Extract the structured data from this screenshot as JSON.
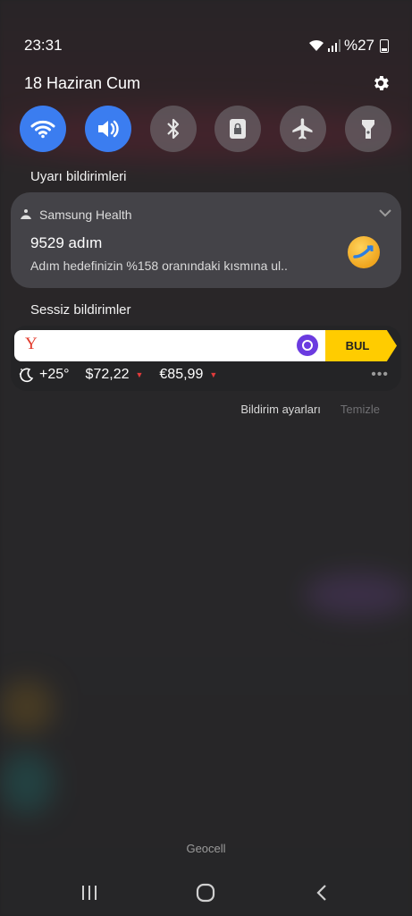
{
  "status_bar": {
    "time": "23:31",
    "battery_text": "%27"
  },
  "header": {
    "date": "18 Haziran Cum",
    "settings_icon": "gear-icon"
  },
  "quick_toggles": [
    {
      "name": "wifi",
      "icon": "wifi-icon",
      "active": true
    },
    {
      "name": "sound",
      "icon": "speaker-icon",
      "active": true
    },
    {
      "name": "bluetooth",
      "icon": "bluetooth-icon",
      "active": false
    },
    {
      "name": "rotation-lock",
      "icon": "lock-icon",
      "active": false
    },
    {
      "name": "airplane",
      "icon": "airplane-icon",
      "active": false
    },
    {
      "name": "flashlight",
      "icon": "flashlight-icon",
      "active": false
    }
  ],
  "sections": {
    "alerts_label": "Uyarı bildirimleri",
    "silent_label": "Sessiz bildirimler"
  },
  "health_notification": {
    "app_name": "Samsung Health",
    "title": "9529 adım",
    "text": "Adım hedefinizin %158 oranındaki kısmına ul.."
  },
  "yandex_widget": {
    "logo_letter": "Y",
    "search_button": "BUL",
    "weather": "+25°",
    "usd": "$72,22",
    "eur": "€85,99",
    "more": "•••"
  },
  "actions": {
    "settings": "Bildirim ayarları",
    "clear": "Temizle"
  },
  "carrier": "Geocell",
  "colors": {
    "accent_blue": "#3b7df0",
    "yandex_yellow": "#ffcc00",
    "alice_purple": "#6b3be0",
    "down_red": "#e23b3b"
  }
}
